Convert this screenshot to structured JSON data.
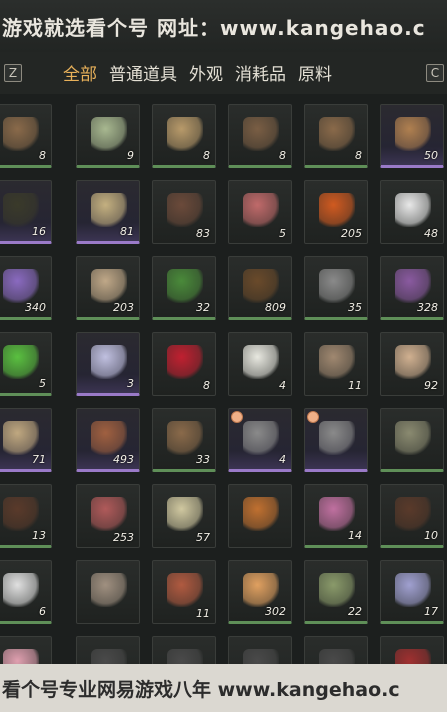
{
  "watermark_top": "游戏就选看个号  网址：www.kangehao.c",
  "watermark_bottom": "看个号专业网易游戏八年  www.kangehao.c",
  "hints": {
    "left": "Z",
    "right": "C"
  },
  "tabs": [
    {
      "label": "全部",
      "active": true
    },
    {
      "label": "普通道具",
      "active": false
    },
    {
      "label": "外观",
      "active": false
    },
    {
      "label": "消耗品",
      "active": false
    },
    {
      "label": "原料",
      "active": false
    }
  ],
  "items": [
    {
      "name": "logs",
      "count": "8",
      "color": "#8a6a4a",
      "rarity": "green"
    },
    {
      "name": "white-herb",
      "count": "9",
      "color": "#a8b890",
      "rarity": "green"
    },
    {
      "name": "grain-sacks",
      "count": "8",
      "color": "#b89a6a",
      "rarity": "green"
    },
    {
      "name": "logs",
      "count": "8",
      "color": "#7a5e44",
      "rarity": "green"
    },
    {
      "name": "logs",
      "count": "8",
      "color": "#8a6a4a",
      "rarity": "green"
    },
    {
      "name": "bread-bowl",
      "count": "50",
      "color": "#b08050",
      "rarity": "purple"
    },
    {
      "name": "scroll-pack",
      "count": "16",
      "color": "#3a3a2a",
      "rarity": "purple"
    },
    {
      "name": "crest-token",
      "count": "81",
      "color": "#c4b080",
      "rarity": "purple"
    },
    {
      "name": "feather",
      "count": "83",
      "color": "#6b4a3a",
      "rarity": ""
    },
    {
      "name": "raw-meat",
      "count": "5",
      "color": "#c06a6a",
      "rarity": ""
    },
    {
      "name": "amber-stone",
      "count": "205",
      "color": "#d05a20",
      "rarity": ""
    },
    {
      "name": "white-fur",
      "count": "48",
      "color": "#e8e8e8",
      "rarity": ""
    },
    {
      "name": "lavender",
      "count": "340",
      "color": "#8a6ac0",
      "rarity": "green"
    },
    {
      "name": "grain-bag",
      "count": "203",
      "color": "#c0a888",
      "rarity": "green"
    },
    {
      "name": "berry-herb",
      "count": "32",
      "color": "#4a8a3a",
      "rarity": "green"
    },
    {
      "name": "cricket",
      "count": "809",
      "color": "#6a4a2a",
      "rarity": "green"
    },
    {
      "name": "ore-rock",
      "count": "35",
      "color": "#8a8a8a",
      "rarity": "green"
    },
    {
      "name": "gem-box",
      "count": "328",
      "color": "#8a5aa0",
      "rarity": "green"
    },
    {
      "name": "jade-orb",
      "count": "5",
      "color": "#5ac040",
      "rarity": "green"
    },
    {
      "name": "moon-sphere",
      "count": "3",
      "color": "#c0c0e0",
      "rarity": "purple"
    },
    {
      "name": "red-crystal",
      "count": "8",
      "color": "#c02030",
      "rarity": ""
    },
    {
      "name": "white-flower",
      "count": "4",
      "color": "#e8e8e0",
      "rarity": ""
    },
    {
      "name": "horn",
      "count": "11",
      "color": "#a08870",
      "rarity": ""
    },
    {
      "name": "mushrooms",
      "count": "92",
      "color": "#d0b090",
      "rarity": ""
    },
    {
      "name": "paper-note",
      "count": "71",
      "color": "#c0a880",
      "rarity": "purple"
    },
    {
      "name": "chest",
      "count": "493",
      "color": "#a06040",
      "rarity": "purple"
    },
    {
      "name": "wood-block",
      "count": "33",
      "color": "#8a6a4a",
      "rarity": "green"
    },
    {
      "name": "talisman",
      "count": "4",
      "color": "#8a8a8a",
      "rarity": "purple",
      "timer": true
    },
    {
      "name": "talisman",
      "count": "",
      "color": "#8a8a8a",
      "rarity": "purple",
      "timer": true
    },
    {
      "name": "fish",
      "count": "",
      "color": "#8a8a70",
      "rarity": "green"
    },
    {
      "name": "cabinet",
      "count": "13",
      "color": "#5a3a2a",
      "rarity": "green"
    },
    {
      "name": "meat-cut",
      "count": "253",
      "color": "#b05a5a",
      "rarity": ""
    },
    {
      "name": "eggs",
      "count": "57",
      "color": "#d0c8a0",
      "rarity": ""
    },
    {
      "name": "fruit",
      "count": "",
      "color": "#c07030",
      "rarity": ""
    },
    {
      "name": "pink-flower",
      "count": "14",
      "color": "#c070a0",
      "rarity": "green"
    },
    {
      "name": "cabinet",
      "count": "10",
      "color": "#5a3a2a",
      "rarity": "green"
    },
    {
      "name": "quill",
      "count": "6",
      "color": "#e0e0e0",
      "rarity": "green"
    },
    {
      "name": "bone",
      "count": "",
      "color": "#a09080",
      "rarity": ""
    },
    {
      "name": "jerky",
      "count": "11",
      "color": "#b05a40",
      "rarity": ""
    },
    {
      "name": "sweets",
      "count": "302",
      "color": "#e0a060",
      "rarity": "green"
    },
    {
      "name": "root-herb",
      "count": "22",
      "color": "#8a9a6a",
      "rarity": "green"
    },
    {
      "name": "purple-flower",
      "count": "17",
      "color": "#a0a0d0",
      "rarity": "green"
    },
    {
      "name": "blossom",
      "count": "",
      "color": "#e0a0b0",
      "rarity": ""
    },
    {
      "name": "misc",
      "count": "",
      "color": "#4a4a4a",
      "rarity": ""
    },
    {
      "name": "misc",
      "count": "",
      "color": "#4a4a4a",
      "rarity": ""
    },
    {
      "name": "misc",
      "count": "",
      "color": "#4a4a4a",
      "rarity": ""
    },
    {
      "name": "misc",
      "count": "",
      "color": "#4a4a4a",
      "rarity": ""
    },
    {
      "name": "misc",
      "count": "",
      "color": "#a03030",
      "rarity": ""
    }
  ]
}
